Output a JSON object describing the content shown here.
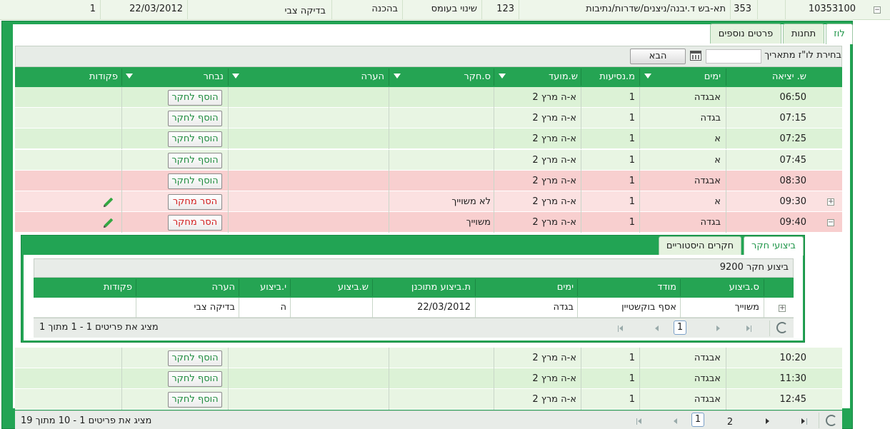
{
  "top_row": {
    "cells": [
      "1",
      "22/03/2012",
      "בדיקה צבי",
      "בהכנה",
      "שינוי בעומס",
      "123",
      "תא-בש ד.יבנה/ניצנים/שדרות/נתיבות",
      "353",
      "10353100"
    ]
  },
  "tabs": [
    {
      "label": "לוז",
      "active": true
    },
    {
      "label": "תחנות",
      "active": false
    },
    {
      "label": "פרטים נוספים",
      "active": false
    }
  ],
  "toolbar": {
    "choose_label": "בחירת לו\"ז מתאריך",
    "date_value": "",
    "next_label": "הבא"
  },
  "grid": {
    "headers": [
      "ש. יציאה",
      "ימים",
      "מ.נסיעות",
      "ש.מועד",
      "ס.חקר",
      "הערה",
      "נבחר",
      "פקודות"
    ],
    "rows": [
      {
        "time": "06:50",
        "days": "אבגדה",
        "trips": "1",
        "when": "א-ה מרץ 2",
        "survey": "",
        "action": "הוסף לחקר",
        "edit": false,
        "color": "g1"
      },
      {
        "time": "07:15",
        "days": "בגדה",
        "trips": "1",
        "when": "א-ה מרץ 2",
        "survey": "",
        "action": "הוסף לחקר",
        "edit": false,
        "color": "g2"
      },
      {
        "time": "07:25",
        "days": "א",
        "trips": "1",
        "when": "א-ה מרץ 2",
        "survey": "",
        "action": "הוסף לחקר",
        "edit": false,
        "color": "g1"
      },
      {
        "time": "07:45",
        "days": "א",
        "trips": "1",
        "when": "א-ה מרץ 2",
        "survey": "",
        "action": "הוסף לחקר",
        "edit": false,
        "color": "g2"
      },
      {
        "time": "08:30",
        "days": "אבגדה",
        "trips": "1",
        "when": "א-ה מרץ 2",
        "survey": "",
        "action": "הוסף לחקר",
        "edit": false,
        "color": "r1"
      },
      {
        "time": "09:30",
        "days": "א",
        "trips": "1",
        "when": "א-ה מרץ 2",
        "survey": "לא משוייך",
        "action": "הסר מחקר",
        "edit": true,
        "color": "r2",
        "expander": "+"
      },
      {
        "time": "09:40",
        "days": "בגדה",
        "trips": "1",
        "when": "א-ה מרץ 2",
        "survey": "משוייך",
        "action": "הסר מחקר",
        "edit": true,
        "color": "r1",
        "expander": "−"
      }
    ],
    "rows_after": [
      {
        "time": "10:20",
        "days": "אבגדה",
        "trips": "1",
        "when": "א-ה מרץ 2",
        "action": "הוסף לחקר",
        "color": "g2"
      },
      {
        "time": "11:30",
        "days": "אבגדה",
        "trips": "1",
        "when": "א-ה מרץ 2",
        "action": "הוסף לחקר",
        "color": "g1"
      },
      {
        "time": "12:45",
        "days": "אבגדה",
        "trips": "1",
        "when": "א-ה מרץ 2",
        "action": "הוסף לחקר",
        "color": "g2"
      }
    ],
    "pager": {
      "summary": "מציג את פריטים 1 - 10 מתוך 19",
      "page1": "1",
      "page2": "2"
    }
  },
  "detail": {
    "tabs": [
      {
        "label": "ביצועי חקר",
        "active": true
      },
      {
        "label": "חקרים היסטוריים",
        "active": false
      }
    ],
    "caption": "ביצוע חקר 9200",
    "headers": [
      "ס.ביצוע",
      "מודד",
      "ימים",
      "ת.ביצוע מתוכנן",
      "ש.ביצוע",
      "י.ביצוע",
      "הערה",
      "פקודות"
    ],
    "row": {
      "status": "משוייך",
      "surveyor": "אסף בוקשטיין",
      "days": "בגדה",
      "planned": "22/03/2012",
      "time": "",
      "day": "ה",
      "note": "בדיקה צבי"
    },
    "pager": {
      "summary": "מציג את פריטים 1 - 1 מתוך 1",
      "page": "1"
    }
  }
}
